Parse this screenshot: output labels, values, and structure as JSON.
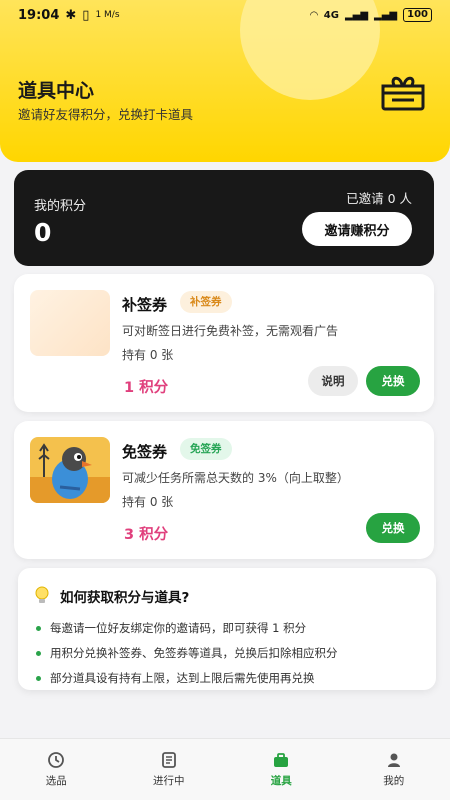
{
  "status_bar": {
    "time": "19:04",
    "net_speed": "1 M/s",
    "signal_label": "4G",
    "battery": "100"
  },
  "header": {
    "title": "道具中心",
    "subtitle": "邀请好友得积分，兑换打卡道具",
    "icon": "gift-box-icon"
  },
  "points": {
    "label": "我的积分",
    "value": "0",
    "invited_text": "已邀请 0 人",
    "invite_button": "邀请赚积分"
  },
  "items": [
    {
      "name": "补签券",
      "tag": "补签券",
      "description": "可对断签日进行免费补签，无需观看广告",
      "hold": "持有 0 张",
      "cost": "1 积分",
      "explain_button": "说明",
      "exchange_button": "兑换"
    },
    {
      "name": "免签券",
      "tag": "免签券",
      "description": "可减少任务所需总天数的 3%（向上取整）",
      "hold": "持有 0 张",
      "cost": "3 积分",
      "exchange_button": "兑换"
    }
  ],
  "howto": {
    "title": "如何获取积分与道具?",
    "items": [
      "每邀请一位好友绑定你的邀请码，即可获得 1 积分",
      "用积分兑换补签券、免签券等道具，兑换后扣除相应积分",
      "部分道具设有持有上限，达到上限后需先使用再兑换"
    ]
  },
  "nav": {
    "items": [
      {
        "label": "选品",
        "icon": "clock-icon"
      },
      {
        "label": "进行中",
        "icon": "document-icon"
      },
      {
        "label": "道具",
        "icon": "toolbox-icon"
      },
      {
        "label": "我的",
        "icon": "person-icon"
      }
    ],
    "active": "道具"
  },
  "colors": {
    "accent_yellow": "#ffd600",
    "accent_green": "#27a341",
    "cost_pink": "#e0407d",
    "dark_card": "#181818"
  }
}
